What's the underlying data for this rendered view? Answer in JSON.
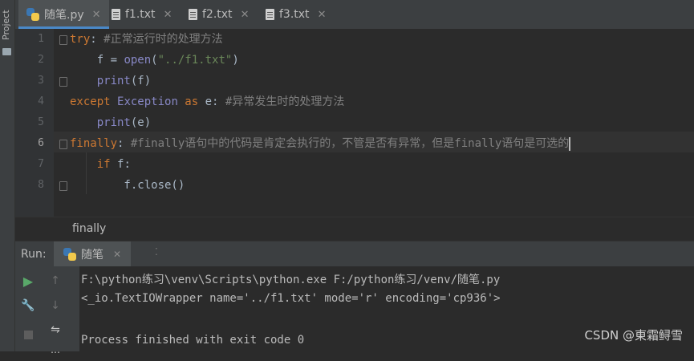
{
  "project_strip": {
    "label": "Project"
  },
  "tabs": [
    {
      "label": "随笔.py",
      "active": true,
      "icon": "python-file-icon"
    },
    {
      "label": "f1.txt",
      "active": false,
      "icon": "text-file-icon"
    },
    {
      "label": "f2.txt",
      "active": false,
      "icon": "text-file-icon"
    },
    {
      "label": "f3.txt",
      "active": false,
      "icon": "text-file-icon"
    }
  ],
  "tab_close_glyph": "✕",
  "editor": {
    "line_numbers": [
      "1",
      "2",
      "3",
      "4",
      "5",
      "6",
      "7",
      "8"
    ],
    "current_line": "6",
    "lines": [
      [
        {
          "t": "try",
          "k": "kw"
        },
        {
          "t": ": "
        },
        {
          "t": "#正常运行时的处理方法",
          "k": "cm"
        }
      ],
      [
        {
          "t": "    f = "
        },
        {
          "t": "open",
          "k": "bi"
        },
        {
          "t": "("
        },
        {
          "t": "\"../f1.txt\"",
          "k": "str"
        },
        {
          "t": ")"
        }
      ],
      [
        {
          "t": "    "
        },
        {
          "t": "print",
          "k": "bi"
        },
        {
          "t": "(f)"
        }
      ],
      [
        {
          "t": "except ",
          "k": "kw"
        },
        {
          "t": "Exception",
          "k": "bi"
        },
        {
          "t": " as ",
          "k": "kw"
        },
        {
          "t": "e: "
        },
        {
          "t": "#异常发生时的处理方法",
          "k": "cm"
        }
      ],
      [
        {
          "t": "    "
        },
        {
          "t": "print",
          "k": "bi"
        },
        {
          "t": "(e)"
        }
      ],
      [
        {
          "t": "finally",
          "k": "kw"
        },
        {
          "t": ": "
        },
        {
          "t": "#finally语句中的代码是肯定会执行的，不管是否有异常，但是finally语句是可选的",
          "k": "cm"
        }
      ],
      [
        {
          "t": "    "
        },
        {
          "t": "if ",
          "k": "kw"
        },
        {
          "t": "f:"
        }
      ],
      [
        {
          "t": "        f.close()"
        }
      ]
    ]
  },
  "breadcrumb": {
    "text": "finally"
  },
  "run_panel": {
    "label": "Run:",
    "tab_label": "随笔",
    "output": [
      "F:\\python练习\\venv\\Scripts\\python.exe F:/python练习/venv/随笔.py",
      "<_io.TextIOWrapper name='../f1.txt' mode='r' encoding='cp936'>",
      "",
      "Process finished with exit code 0"
    ]
  },
  "watermark": "CSDN @東霜鲟雪",
  "colors": {
    "keyword": "#cc7832",
    "builtin": "#8888c6",
    "string": "#6a8759",
    "comment": "#808080",
    "run": "#59a869",
    "tab_underline": "#4a88c7"
  }
}
